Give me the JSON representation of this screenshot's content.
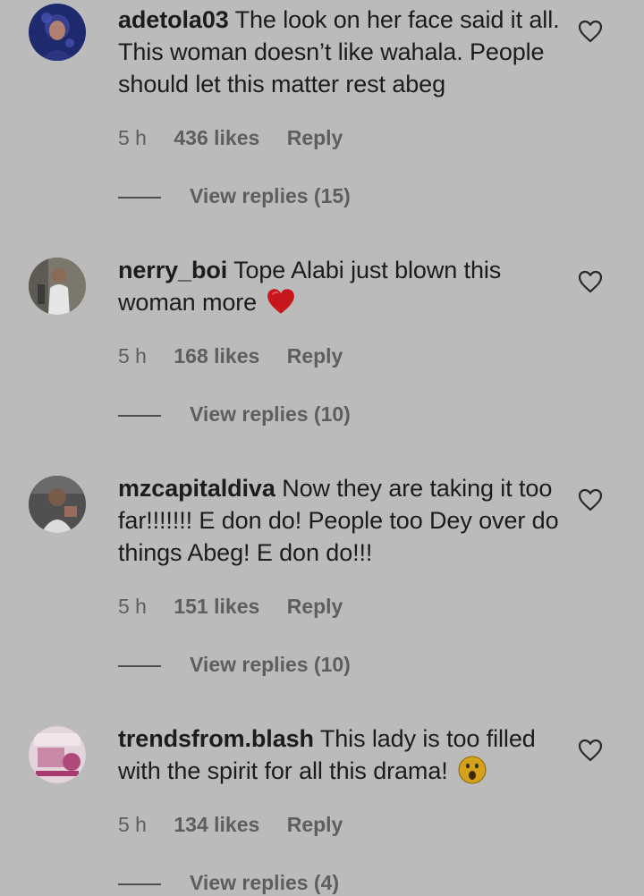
{
  "comments": [
    {
      "username": "adetola03",
      "text": "The look on her face said it all. This woman doesn’t like wahala. People should let this matter rest abeg",
      "time": "5 h",
      "likes": "436 likes",
      "reply_label": "Reply",
      "view_replies": "View replies (15)",
      "avatar_icon": "avatar-image",
      "avatar_color": "#1f2a6e"
    },
    {
      "username": "nerry_boi",
      "text": "Tope Alabi just blown this woman more",
      "emoji": "red-heart",
      "time": "5 h",
      "likes": "168 likes",
      "reply_label": "Reply",
      "view_replies": "View replies (10)",
      "avatar_icon": "avatar-image",
      "avatar_color": "#6e6a5e"
    },
    {
      "username": "mzcapitaldiva",
      "text": "Now they are taking it too far!!!!!!! E don do! People too Dey over do things Abeg! E don do!!!",
      "time": "5 h",
      "likes": "151 likes",
      "reply_label": "Reply",
      "view_replies": "View replies (10)",
      "avatar_icon": "avatar-image",
      "avatar_color": "#4a4a4a"
    },
    {
      "username": "trendsfrom.blash",
      "text": "This lady is too filled with the spirit for all this drama!",
      "emoji": "astonished-face",
      "time": "5 h",
      "likes": "134 likes",
      "reply_label": "Reply",
      "view_replies": "View replies (4)",
      "avatar_icon": "avatar-image",
      "avatar_color": "#d9b7c8"
    }
  ]
}
